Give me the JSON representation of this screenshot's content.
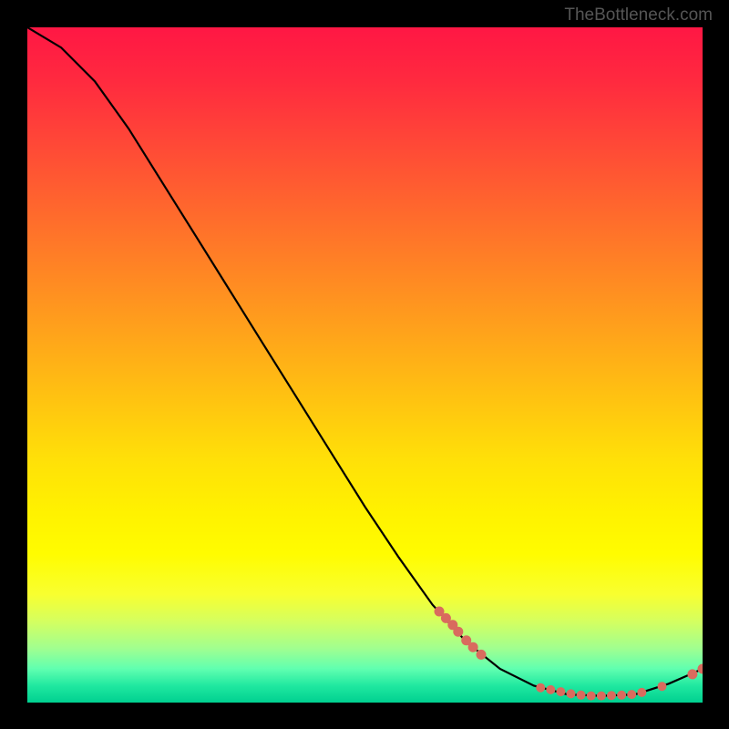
{
  "watermark": "TheBottleneck.com",
  "chart_data": {
    "type": "line",
    "title": "",
    "xlabel": "",
    "ylabel": "",
    "xlim": [
      0,
      100
    ],
    "ylim": [
      0,
      100
    ],
    "curve": [
      {
        "x": 0,
        "y": 100
      },
      {
        "x": 5,
        "y": 97
      },
      {
        "x": 10,
        "y": 92
      },
      {
        "x": 15,
        "y": 85
      },
      {
        "x": 20,
        "y": 77
      },
      {
        "x": 25,
        "y": 69
      },
      {
        "x": 30,
        "y": 61
      },
      {
        "x": 35,
        "y": 53
      },
      {
        "x": 40,
        "y": 45
      },
      {
        "x": 45,
        "y": 37
      },
      {
        "x": 50,
        "y": 29
      },
      {
        "x": 55,
        "y": 21.5
      },
      {
        "x": 60,
        "y": 14.5
      },
      {
        "x": 65,
        "y": 9
      },
      {
        "x": 70,
        "y": 5
      },
      {
        "x": 75,
        "y": 2.5
      },
      {
        "x": 80,
        "y": 1.2
      },
      {
        "x": 85,
        "y": 1.0
      },
      {
        "x": 90,
        "y": 1.2
      },
      {
        "x": 95,
        "y": 2.8
      },
      {
        "x": 100,
        "y": 5
      }
    ],
    "markers_cluster_a": [
      {
        "x": 61,
        "y": 13.5
      },
      {
        "x": 62,
        "y": 12.5
      },
      {
        "x": 63,
        "y": 11.5
      },
      {
        "x": 63.8,
        "y": 10.5
      },
      {
        "x": 65,
        "y": 9.2
      },
      {
        "x": 66,
        "y": 8.2
      },
      {
        "x": 67.2,
        "y": 7.1
      }
    ],
    "markers_cluster_b": [
      {
        "x": 76,
        "y": 2.2
      },
      {
        "x": 77.5,
        "y": 1.9
      },
      {
        "x": 79,
        "y": 1.6
      },
      {
        "x": 80.5,
        "y": 1.3
      },
      {
        "x": 82,
        "y": 1.1
      },
      {
        "x": 83.5,
        "y": 1.0
      },
      {
        "x": 85,
        "y": 1.0
      },
      {
        "x": 86.5,
        "y": 1.05
      },
      {
        "x": 88,
        "y": 1.1
      },
      {
        "x": 89.5,
        "y": 1.2
      },
      {
        "x": 91,
        "y": 1.5
      },
      {
        "x": 94,
        "y": 2.4
      }
    ],
    "markers_cluster_c": [
      {
        "x": 98.5,
        "y": 4.2
      },
      {
        "x": 100,
        "y": 5.0
      }
    ],
    "marker_color": "#d96b5e",
    "line_color": "#000000"
  }
}
